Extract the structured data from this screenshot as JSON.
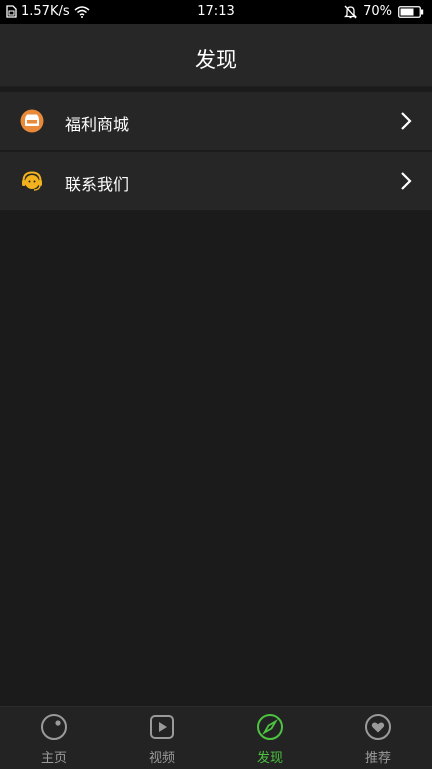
{
  "status_bar": {
    "network_speed": "1.57K/s",
    "time": "17:13",
    "battery": "70%",
    "icons": [
      "sim-icon",
      "wifi-icon",
      "silent-bell-icon",
      "battery-icon"
    ]
  },
  "header": {
    "title": "发现"
  },
  "list": {
    "items": [
      {
        "label": "福利商城",
        "icon": "shop-icon"
      },
      {
        "label": "联系我们",
        "icon": "support-icon"
      }
    ]
  },
  "bottom_nav": {
    "items": [
      {
        "label": "主页",
        "icon": "home-icon"
      },
      {
        "label": "视频",
        "icon": "video-icon"
      },
      {
        "label": "发现",
        "icon": "compass-icon",
        "active": true
      },
      {
        "label": "推荐",
        "icon": "heart-icon"
      }
    ]
  },
  "colors": {
    "background": "#1b1b1b",
    "header": "#272727",
    "accent": "#4cc341",
    "icon_orange": "#e98a3a",
    "icon_yellow": "#f2b21d",
    "inactive": "#9a9a9a"
  }
}
